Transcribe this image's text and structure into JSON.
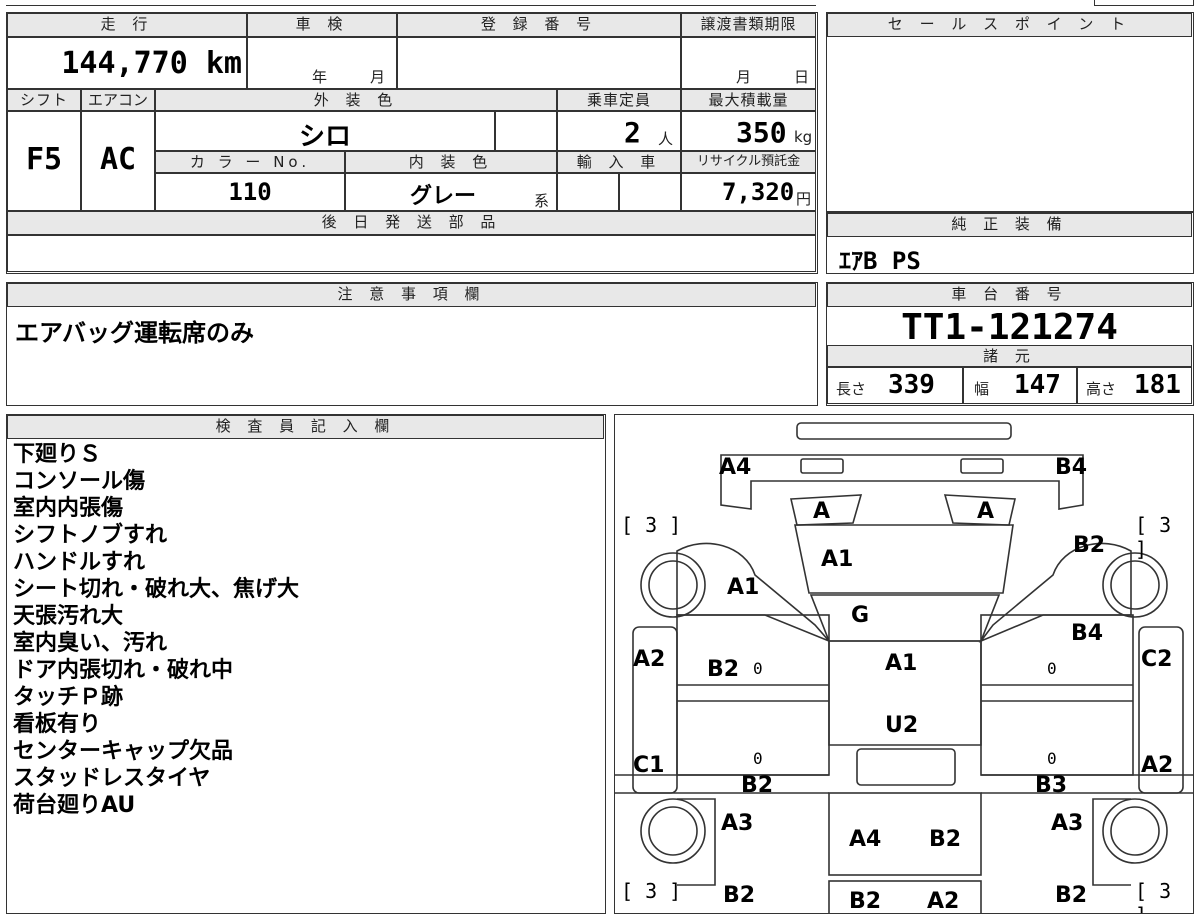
{
  "summary": {
    "mileage_label": "走 行",
    "mileage_value": "144,770 km",
    "inspection_label": "車 検",
    "inspection_year_unit": "年",
    "inspection_month_unit": "月",
    "registration_label": "登 録 番 号",
    "transfer_label": "譲渡書類期限",
    "transfer_month_unit": "月",
    "transfer_day_unit": "日",
    "shift_label": "シフト",
    "shift_value": "F5",
    "ac_label": "エアコン",
    "ac_value": "AC",
    "exterior_label": "外 装 色",
    "exterior_value": "シロ",
    "capacity_label": "乗車定員",
    "capacity_value": "2",
    "capacity_unit": "人",
    "maxload_label": "最大積載量",
    "maxload_value": "350",
    "maxload_unit": "kg",
    "color_no_label": "カ ラ ー No.",
    "color_no_value": "110",
    "interior_label": "内 装 色",
    "interior_value": "グレー",
    "interior_suffix": "系",
    "import_label": "輸 入 車",
    "recycle_label": "リサイクル預託金",
    "recycle_value": "7,320",
    "recycle_unit": "円",
    "later_parts_label": "後 日 発 送 部 品"
  },
  "sales_point": {
    "label": "セ ー ル ス ポ イ ン ト"
  },
  "genuine_equipment": {
    "label": "純 正 装 備",
    "value": "ｴｱB PS"
  },
  "notes": {
    "label": "注 意 事 項 欄",
    "value": "エアバッグ運転席のみ"
  },
  "chassis": {
    "label": "車 台 番 号",
    "value": "TT1-121274"
  },
  "specs": {
    "label": "諸 元",
    "length_label": "長さ",
    "length_value": "339",
    "width_label": "幅",
    "width_value": "147",
    "height_label": "高さ",
    "height_value": "181"
  },
  "inspector": {
    "label": "検 査 員 記 入 欄",
    "lines": [
      "下廻りＳ",
      "コンソール傷",
      "室内内張傷",
      "シフトノブすれ",
      "ハンドルすれ",
      "シート切れ・破れ大、焦げ大",
      "天張汚れ大",
      "室内臭い、汚れ",
      "ドア内張切れ・破れ中",
      "タッチＰ跡",
      "看板有り",
      "センターキャップ欠品",
      "スタッドレスタイヤ",
      "荷台廻りAU"
    ]
  },
  "diagram": {
    "tire_marks": {
      "fl": "[ 3 ]",
      "fr": "[ 3 ]",
      "rl": "[ 3 ]",
      "rr": "[ 3 ]"
    },
    "damage": {
      "front_left_corner": "A4",
      "front_right_corner": "B4",
      "lamp_left": "A",
      "lamp_right": "A",
      "windshield": "A1",
      "right_fender": "B2",
      "left_fender": "A1",
      "cowl": "G",
      "right_door_front": "B4",
      "roof": "A1",
      "left_door_front": "A2",
      "left_pillar": "B2",
      "right_pillar": "C2",
      "cab_rear": "U2",
      "left_lower": "C1",
      "left_sill": "B2",
      "right_sill": "B3",
      "right_lower": "A2",
      "left_rear_fender": "A3",
      "bed_left": "A4",
      "bed_right": "B2",
      "right_rear_fender": "A3",
      "left_rear_bottom": "B2",
      "bed_bottom_left": "B2",
      "bed_bottom_right": "A2",
      "right_rear_bottom": "B2"
    },
    "zero_marks": [
      "0",
      "0",
      "0",
      "0"
    ]
  }
}
